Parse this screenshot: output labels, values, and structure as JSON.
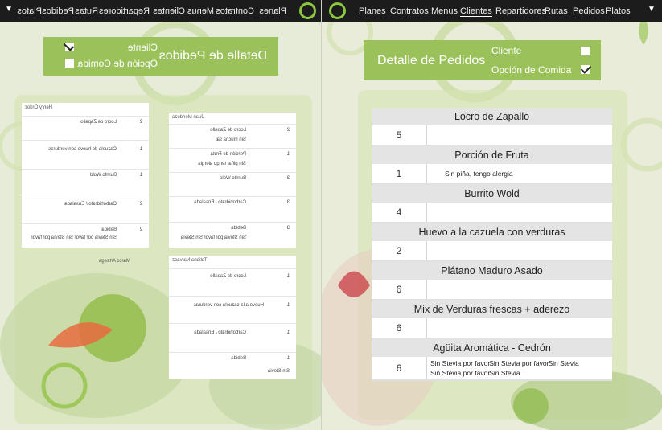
{
  "nav": {
    "items": [
      "Planes",
      "Contratos",
      "Menus",
      "Clientes",
      "Repartidores",
      "Rutas",
      "Pedidos",
      "Platos"
    ],
    "active": "Clientes",
    "caret": "▼"
  },
  "header": {
    "title": "Detalle de Pedidos",
    "cliente_label": "Cliente",
    "cliente_checked": false,
    "opcion_label": "Opción de Comida",
    "opcion_checked": true
  },
  "orders": [
    {
      "dish": "Locro de Zapallo",
      "qty": "5",
      "notes": []
    },
    {
      "dish": "Porción de Fruta",
      "qty": "1",
      "notes": [
        "Sin piña, tengo alergia"
      ]
    },
    {
      "dish": "Burrito Wold",
      "qty": "4",
      "notes": []
    },
    {
      "dish": "Huevo a la cazuela con verduras",
      "qty": "2",
      "notes": []
    },
    {
      "dish": "Plátano Maduro Asado",
      "qty": "6",
      "notes": []
    },
    {
      "dish": "Mix de Verduras frescas + aderezo",
      "qty": "6",
      "notes": []
    },
    {
      "dish": "Agüita Aromática - Cedrón",
      "qty": "6",
      "notes": [
        "Sin Stevia por favor",
        "Sin Stevia por favor",
        "Sin Stevia",
        "Sin Stevia por favor",
        "Sin Stevia"
      ]
    }
  ],
  "left_view": {
    "header": {
      "title": "Detalle de Pedidos",
      "cliente_label": "Cliente",
      "cliente_checked": true,
      "opcion_label": "Opción de Comida",
      "opcion_checked": false
    },
    "columns": [
      {
        "client": "Juan Mendoza",
        "rows": [
          {
            "dish": "Locro de Zapallo",
            "qty": "2",
            "note": "Sin mucha sal"
          },
          {
            "dish": "Porción de Fruta",
            "qty": "1",
            "note": "Sin piña, tengo alergia"
          },
          {
            "dish": "Burrito Wold",
            "qty": "3",
            "note": ""
          },
          {
            "dish": "Carbohidrato / Ensalada",
            "qty": "3",
            "note": ""
          },
          {
            "dish": "Bebida",
            "qty": "3",
            "note": "Sin Stevia por favor Sin Stevia"
          }
        ]
      },
      {
        "client": "Henry Ordoz",
        "rows": [
          {
            "dish": "Locro de Zapallo",
            "qty": "2",
            "note": ""
          },
          {
            "dish": "Cazuela de huevo con verduras",
            "qty": "1",
            "note": ""
          },
          {
            "dish": "Burrito Wold",
            "qty": "1",
            "note": ""
          },
          {
            "dish": "Carbohidrato / Ensalada",
            "qty": "2",
            "note": ""
          },
          {
            "dish": "Bebida",
            "qty": "2",
            "note": "Sin Stevia por favor Sin Stevia por favor"
          }
        ]
      },
      {
        "client": "Tatiana Narvaez",
        "rows": [
          {
            "dish": "Locro de Zapallo",
            "qty": "1",
            "note": ""
          },
          {
            "dish": "Huevo a la cazuela con verduras",
            "qty": "1",
            "note": ""
          },
          {
            "dish": "Carbohidrato / Ensalada",
            "qty": "1",
            "note": ""
          },
          {
            "dish": "Bebida",
            "qty": "1",
            "note": "Sin Stevia"
          }
        ]
      }
    ],
    "extra_label": "Marco Arteaga"
  },
  "colors": {
    "nav_bg": "#1c1c1c",
    "accent_green": "#9bc25a",
    "logo_green": "#8cc63f"
  }
}
